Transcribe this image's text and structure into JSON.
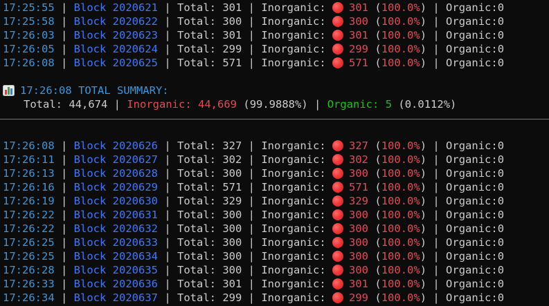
{
  "logs_top": [
    {
      "time": "17:25:55",
      "block_label": "Block",
      "block_num": "2020621",
      "total_label": "Total:",
      "total": "301",
      "inorganic_label": "Inorganic:",
      "inorganic": "301",
      "pct": "100.0%",
      "organic_label": "Organic:",
      "organic": "0"
    },
    {
      "time": "17:25:58",
      "block_label": "Block",
      "block_num": "2020622",
      "total_label": "Total:",
      "total": "300",
      "inorganic_label": "Inorganic:",
      "inorganic": "300",
      "pct": "100.0%",
      "organic_label": "Organic:",
      "organic": "0"
    },
    {
      "time": "17:26:03",
      "block_label": "Block",
      "block_num": "2020623",
      "total_label": "Total:",
      "total": "301",
      "inorganic_label": "Inorganic:",
      "inorganic": "301",
      "pct": "100.0%",
      "organic_label": "Organic:",
      "organic": "0"
    },
    {
      "time": "17:26:05",
      "block_label": "Block",
      "block_num": "2020624",
      "total_label": "Total:",
      "total": "299",
      "inorganic_label": "Inorganic:",
      "inorganic": "299",
      "pct": "100.0%",
      "organic_label": "Organic:",
      "organic": "0"
    },
    {
      "time": "17:26:08",
      "block_label": "Block",
      "block_num": "2020625",
      "total_label": "Total:",
      "total": "571",
      "inorganic_label": "Inorganic:",
      "inorganic": "571",
      "pct": "100.0%",
      "organic_label": "Organic:",
      "organic": "0"
    }
  ],
  "summary": {
    "icon": "bar-chart-icon",
    "title": "17:26:08 TOTAL SUMMARY:",
    "total_label": "Total:",
    "total": "44,674",
    "inorganic_label": "Inorganic:",
    "inorganic": "44,669",
    "inorganic_pct": "(99.9888%)",
    "organic_label": "Organic:",
    "organic": "5",
    "organic_pct": "(0.0112%)"
  },
  "logs_bottom": [
    {
      "time": "17:26:08",
      "block_label": "Block",
      "block_num": "2020626",
      "total_label": "Total:",
      "total": "327",
      "inorganic_label": "Inorganic:",
      "inorganic": "327",
      "pct": "100.0%",
      "organic_label": "Organic:",
      "organic": "0"
    },
    {
      "time": "17:26:11",
      "block_label": "Block",
      "block_num": "2020627",
      "total_label": "Total:",
      "total": "302",
      "inorganic_label": "Inorganic:",
      "inorganic": "302",
      "pct": "100.0%",
      "organic_label": "Organic:",
      "organic": "0"
    },
    {
      "time": "17:26:13",
      "block_label": "Block",
      "block_num": "2020628",
      "total_label": "Total:",
      "total": "300",
      "inorganic_label": "Inorganic:",
      "inorganic": "300",
      "pct": "100.0%",
      "organic_label": "Organic:",
      "organic": "0"
    },
    {
      "time": "17:26:16",
      "block_label": "Block",
      "block_num": "2020629",
      "total_label": "Total:",
      "total": "571",
      "inorganic_label": "Inorganic:",
      "inorganic": "571",
      "pct": "100.0%",
      "organic_label": "Organic:",
      "organic": "0"
    },
    {
      "time": "17:26:19",
      "block_label": "Block",
      "block_num": "2020630",
      "total_label": "Total:",
      "total": "329",
      "inorganic_label": "Inorganic:",
      "inorganic": "329",
      "pct": "100.0%",
      "organic_label": "Organic:",
      "organic": "0"
    },
    {
      "time": "17:26:22",
      "block_label": "Block",
      "block_num": "2020631",
      "total_label": "Total:",
      "total": "300",
      "inorganic_label": "Inorganic:",
      "inorganic": "300",
      "pct": "100.0%",
      "organic_label": "Organic:",
      "organic": "0"
    },
    {
      "time": "17:26:22",
      "block_label": "Block",
      "block_num": "2020632",
      "total_label": "Total:",
      "total": "300",
      "inorganic_label": "Inorganic:",
      "inorganic": "300",
      "pct": "100.0%",
      "organic_label": "Organic:",
      "organic": "0"
    },
    {
      "time": "17:26:25",
      "block_label": "Block",
      "block_num": "2020633",
      "total_label": "Total:",
      "total": "300",
      "inorganic_label": "Inorganic:",
      "inorganic": "300",
      "pct": "100.0%",
      "organic_label": "Organic:",
      "organic": "0"
    },
    {
      "time": "17:26:25",
      "block_label": "Block",
      "block_num": "2020634",
      "total_label": "Total:",
      "total": "300",
      "inorganic_label": "Inorganic:",
      "inorganic": "300",
      "pct": "100.0%",
      "organic_label": "Organic:",
      "organic": "0"
    },
    {
      "time": "17:26:28",
      "block_label": "Block",
      "block_num": "2020635",
      "total_label": "Total:",
      "total": "300",
      "inorganic_label": "Inorganic:",
      "inorganic": "300",
      "pct": "100.0%",
      "organic_label": "Organic:",
      "organic": "0"
    },
    {
      "time": "17:26:33",
      "block_label": "Block",
      "block_num": "2020636",
      "total_label": "Total:",
      "total": "301",
      "inorganic_label": "Inorganic:",
      "inorganic": "301",
      "pct": "100.0%",
      "organic_label": "Organic:",
      "organic": "0"
    },
    {
      "time": "17:26:34",
      "block_label": "Block",
      "block_num": "2020637",
      "total_label": "Total:",
      "total": "299",
      "inorganic_label": "Inorganic:",
      "inorganic": "299",
      "pct": "100.0%",
      "organic_label": "Organic:",
      "organic": "0"
    }
  ],
  "icons": {
    "status_dot": "red-circle-icon",
    "summary": "bar-chart-icon"
  },
  "colors": {
    "background": "#0c0c0c",
    "time": "#3a96dd",
    "block": "#3b78ff",
    "inorganic": "#e74856",
    "organic": "#16c60c",
    "text": "#cccccc"
  }
}
